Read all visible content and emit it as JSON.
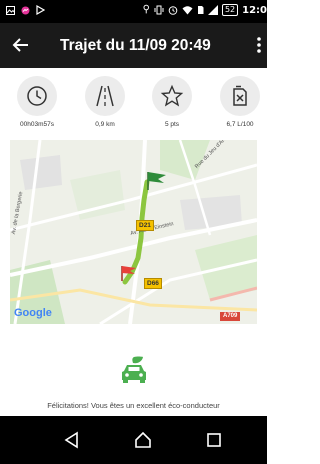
{
  "status_bar": {
    "battery": "52",
    "time": "12:0",
    "icons": [
      "image-icon",
      "messenger-icon",
      "play-icon",
      "location-icon",
      "vibrate-icon",
      "alarm-icon",
      "wifi-icon",
      "sim-icon",
      "signal-icon",
      "battery-icon"
    ]
  },
  "app_bar": {
    "title": "Trajet du 11/09 20:49",
    "back_icon": "arrow-left-icon",
    "menu_icon": "more-vertical-icon"
  },
  "stats": [
    {
      "icon": "clock-icon",
      "label": "00h03m57s"
    },
    {
      "icon": "road-icon",
      "label": "0,9 km"
    },
    {
      "icon": "star-icon",
      "label": "5 pts"
    },
    {
      "icon": "fuel-icon",
      "label": "6,7 L/100"
    }
  ],
  "map": {
    "labels": {
      "street_left": "Av. de la Bergerie",
      "street_top_right": "Rue du Jeu d'Arc",
      "street_center": "Av. Albert Einstein"
    },
    "road_shields": {
      "d21": "D21",
      "d66": "D66",
      "a709": "A709"
    },
    "provider": "Google",
    "route_color": "#8cc63f",
    "start_flag_color": "#e8403a",
    "end_flag_color": "#2e8b3a"
  },
  "eco_badge": {
    "icon": "eco-car-icon",
    "color": "#4caf50"
  },
  "message": "Félicitations! Vous êtes un excellent éco-conducteur",
  "nav_bar": {
    "back": "back-icon",
    "home": "home-icon",
    "recents": "recents-icon"
  }
}
